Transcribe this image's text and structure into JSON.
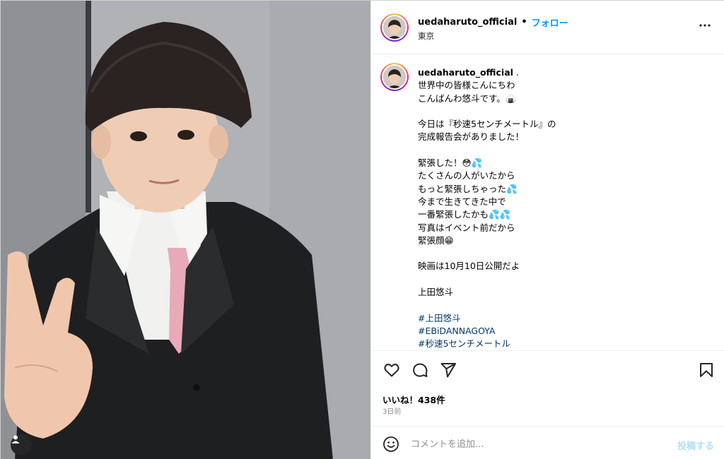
{
  "post": {
    "username": "uedaharuto_official",
    "separator": "•",
    "follow_label": "フォロー",
    "location": "東京",
    "caption_user": "uedaharuto_official",
    "caption_user_suffix": " .",
    "caption_lines": [
      "世界中の皆様こんにちわ",
      "こんばんわ悠斗です。🍙",
      "",
      "今日は『秒速5センチメートル』の",
      "完成報告会がありました！",
      "",
      "緊張した！😳💦",
      "たくさんの人がいたから",
      "もっと緊張しちゃった💦",
      "今まで生きてきた中で",
      "一番緊張したかも💦💦",
      "写真はイベント前だから",
      "緊張顔😁",
      "",
      "映画は10月10日公開だよ",
      "",
      "上田悠斗",
      ""
    ],
    "hashtags": [
      "#上田悠斗",
      "#EBiDANNAGOYA",
      "#秒速5センチメートル"
    ],
    "likes_text": "いいね！438件",
    "time_text": "3日前",
    "comment_placeholder": "コメントを追加...",
    "post_button": "投稿する"
  },
  "icons": {
    "more": "more-options-icon",
    "like": "heart-icon",
    "comment": "comment-icon",
    "share": "share-icon",
    "save": "bookmark-icon",
    "emoji": "emoji-icon",
    "tag": "user-tag-icon"
  },
  "colors": {
    "accent": "#0095f6",
    "hashtag": "#00376b",
    "muted": "#8e8e8e",
    "post_disabled": "#b2dffc"
  }
}
